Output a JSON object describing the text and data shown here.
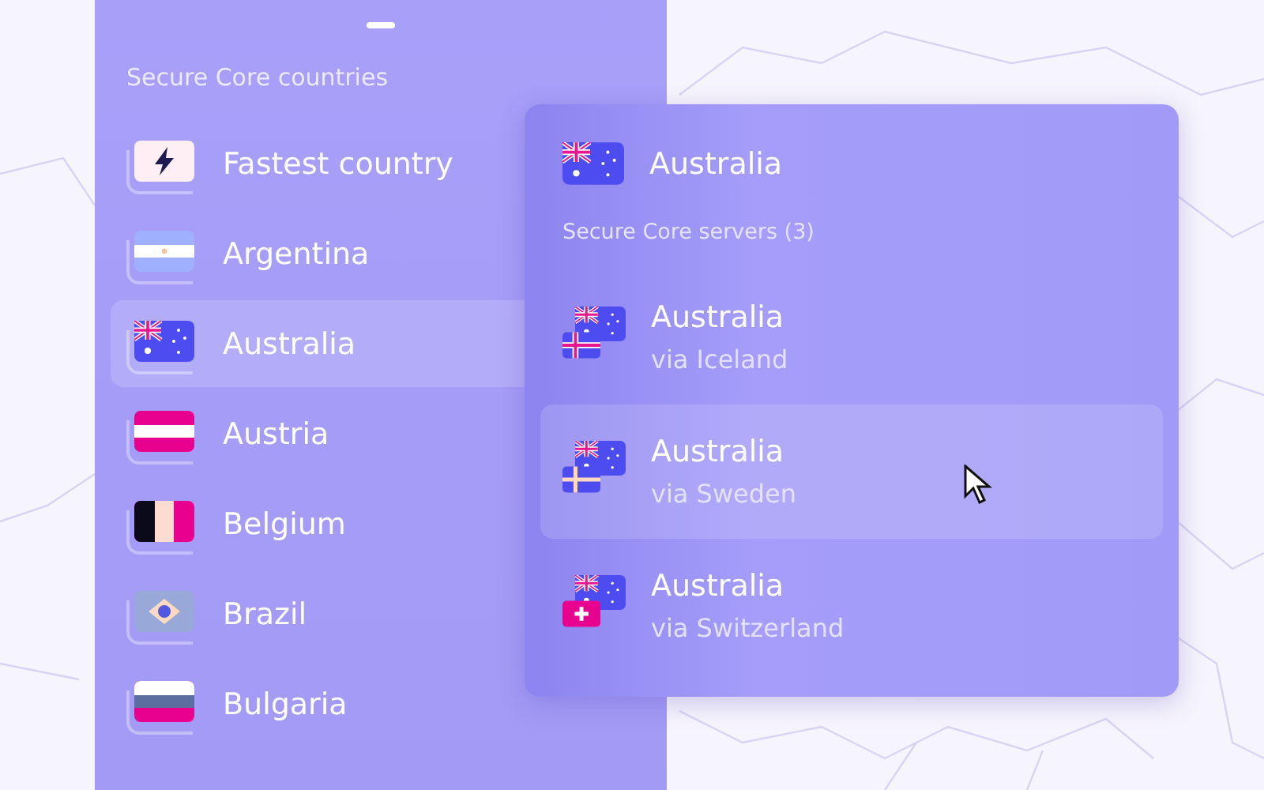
{
  "sidebar": {
    "title": "Secure Core countries",
    "items": [
      {
        "name": "Fastest country",
        "kind": "fastest",
        "selected": false
      },
      {
        "name": "Argentina",
        "kind": "argentina",
        "selected": false
      },
      {
        "name": "Australia",
        "kind": "australia",
        "selected": true
      },
      {
        "name": "Austria",
        "kind": "austria",
        "selected": false
      },
      {
        "name": "Belgium",
        "kind": "belgium",
        "selected": false
      },
      {
        "name": "Brazil",
        "kind": "brazil",
        "selected": false
      },
      {
        "name": "Bulgaria",
        "kind": "bulgaria",
        "selected": false
      }
    ]
  },
  "popup": {
    "country": {
      "name": "Australia",
      "kind": "australia"
    },
    "section_title": "Secure Core servers (3)",
    "servers": [
      {
        "name": "Australia",
        "via": "via Iceland",
        "flags": [
          {
            "kind": "australia"
          },
          {
            "kind": "iceland"
          }
        ],
        "selected": false
      },
      {
        "name": "Australia",
        "via": "via Sweden",
        "flags": [
          {
            "kind": "australia"
          },
          {
            "kind": "sweden"
          }
        ],
        "selected": true
      },
      {
        "name": "Australia",
        "via": "via Switzerland",
        "flags": [
          {
            "kind": "australia"
          },
          {
            "kind": "switzerland"
          }
        ],
        "selected": false
      }
    ]
  }
}
